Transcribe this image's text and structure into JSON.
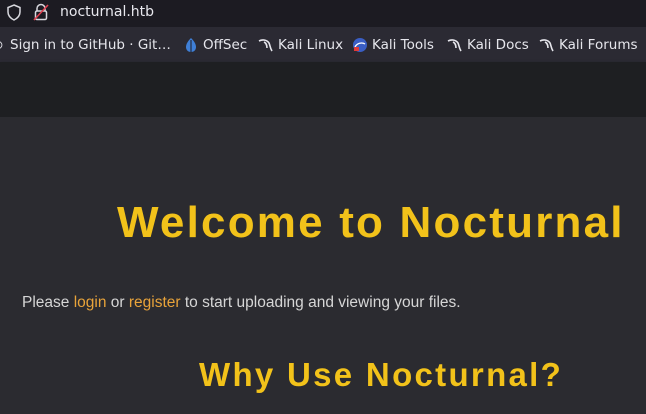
{
  "browser": {
    "url": "nocturnal.htb"
  },
  "bookmarks": [
    {
      "label": "Sign in to GitHub · Git…",
      "icon": "github-icon"
    },
    {
      "label": "OffSec",
      "icon": "offsec-icon"
    },
    {
      "label": "Kali Linux",
      "icon": "kali-dragon-icon"
    },
    {
      "label": "Kali Tools",
      "icon": "kali-tools-icon"
    },
    {
      "label": "Kali Docs",
      "icon": "kali-dragon-icon"
    },
    {
      "label": "Kali Forums",
      "icon": "kali-dragon-icon"
    }
  ],
  "page": {
    "heading": "Welcome to Nocturnal",
    "intro_prefix": "Please ",
    "login_link": "login",
    "intro_or": " or ",
    "register_link": "register",
    "intro_suffix": " to start uploading and viewing your files.",
    "subheading": "Why Use Nocturnal?"
  },
  "colors": {
    "heading": "#f2c21a",
    "link": "#e8a33a",
    "page_bg": "#2b2b30",
    "banner_bg": "#1e1f22"
  }
}
